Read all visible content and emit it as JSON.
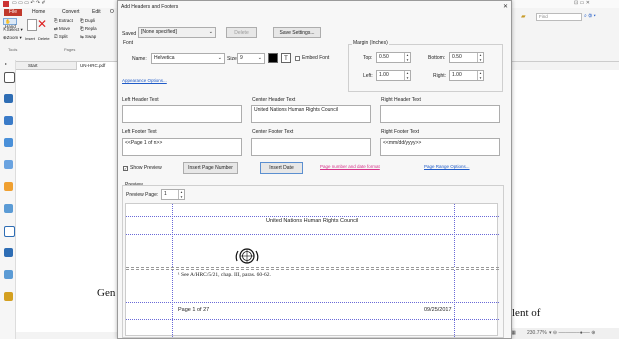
{
  "ribbon": {
    "tabs": [
      "File",
      "Home",
      "Convert",
      "Edit",
      "O"
    ],
    "hand": "Hand",
    "select": "Select",
    "zoom": "Zoom",
    "insert": "Insert",
    "delete": "Delete",
    "extract": "Extract",
    "duplicate": "Dupli",
    "move": "Move",
    "replace": "Repla",
    "split": "Split",
    "swap": "Swap",
    "tools_label": "Tools",
    "pages_label": "Pages",
    "find_placeholder": "Find"
  },
  "tabs": {
    "start": "Start",
    "doc": "UN-HRC.pdf"
  },
  "dialog": {
    "title": "Add Headers and Footers",
    "saved_settings_label": "Saved Settings:",
    "saved_settings_value": "[None specified]",
    "delete_btn": "Delete",
    "save_settings_btn": "Save Settings...",
    "font_label": "Font",
    "name_label": "Name:",
    "name_value": "Helvetica",
    "size_label": "Size:",
    "size_value": "9",
    "embed_font": "Embed Font",
    "margin_label": "Margin (Inches)",
    "top_label": "Top:",
    "top_value": "0.50",
    "bottom_label": "Bottom:",
    "bottom_value": "0.50",
    "left_label": "Left:",
    "left_value": "1.00",
    "right_label": "Right:",
    "right_value": "1.00",
    "appearance_options": "Appearance Options...",
    "left_header": "Left Header Text",
    "center_header": "Center Header Text",
    "right_header": "Right Header Text",
    "center_header_value": "United Nations Human Rights Council",
    "left_footer": "Left Footer Text",
    "center_footer": "Center Footer Text",
    "right_footer": "Right Footer Text",
    "left_footer_value": "<<Page 1 of n>>",
    "right_footer_value": "<<mm/dd/yyyy>>",
    "show_preview": "Show Preview",
    "insert_page_number": "Insert Page Number",
    "insert_date": "Insert Date",
    "page_number_format": "Page number and date format",
    "page_range_options": "Page Range Options...",
    "preview_label": "Preview",
    "preview_page_label": "Preview Page:",
    "preview_page_value": "1",
    "preview_header": "United Nations Human Rights Council",
    "preview_footnote": "¹ See A/HRC/5/21, chap. III, paras. 60-62.",
    "preview_page": "Page 1 of 27",
    "preview_date": "09/25/2017"
  },
  "background": {
    "gen_text": "Gen",
    "lent_text": "lent of"
  },
  "status": {
    "zoom": "230.77%"
  }
}
